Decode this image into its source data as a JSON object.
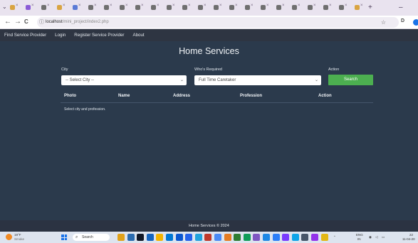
{
  "browser": {
    "tabs": [
      {
        "color": "#d9a441"
      },
      {
        "color": "#8a5bd6"
      },
      {
        "color": "#6f6f6f"
      },
      {
        "color": "#d9a441"
      },
      {
        "color": "#5b7bd6"
      },
      {
        "color": "#6f6f6f"
      },
      {
        "color": "#6f6f6f"
      },
      {
        "color": "#6f6f6f"
      },
      {
        "color": "#6f6f6f"
      },
      {
        "color": "#6f6f6f"
      },
      {
        "color": "#6f6f6f"
      },
      {
        "color": "#6f6f6f"
      },
      {
        "color": "#6f6f6f"
      },
      {
        "color": "#6f6f6f"
      },
      {
        "color": "#6f6f6f"
      },
      {
        "color": "#6f6f6f"
      },
      {
        "color": "#6f6f6f"
      },
      {
        "color": "#6f6f6f"
      },
      {
        "color": "#6f6f6f"
      },
      {
        "color": "#6f6f6f"
      },
      {
        "color": "#6f6f6f"
      },
      {
        "color": "#6f6f6f"
      },
      {
        "color": "#d9a441"
      }
    ],
    "new_tab": "+",
    "minimize": "–",
    "back": "←",
    "forward": "→",
    "reload": "C",
    "url_host": "localhost",
    "url_path": "/mini_project/index2.php",
    "star": "☆",
    "download": "D"
  },
  "nav": {
    "items": [
      "Find Service Provider",
      "Login",
      "Register Service Provider",
      "About"
    ]
  },
  "page": {
    "title": "Home Services",
    "city_label": "City",
    "city_value": "-- Select City --",
    "who_label": "Who's Required",
    "who_value": "Full Time Caretaker",
    "action_label": "Action",
    "search_label": "Search",
    "table_headers": [
      "Photo",
      "Name",
      "Address",
      "Profession",
      "Action"
    ],
    "empty_message": "Select city and profession."
  },
  "footer": {
    "text": "Home Services © 2024"
  },
  "taskbar": {
    "temp": "19°F",
    "weather": "Smoke",
    "search": "Search",
    "lang_top": "ENG",
    "lang_bottom": "IN",
    "time": "22",
    "date": "11-04-20"
  },
  "colors": {
    "accent_green": "#4caf50",
    "page_bg": "#2b3a4c",
    "nav_bg": "#2e3542"
  }
}
